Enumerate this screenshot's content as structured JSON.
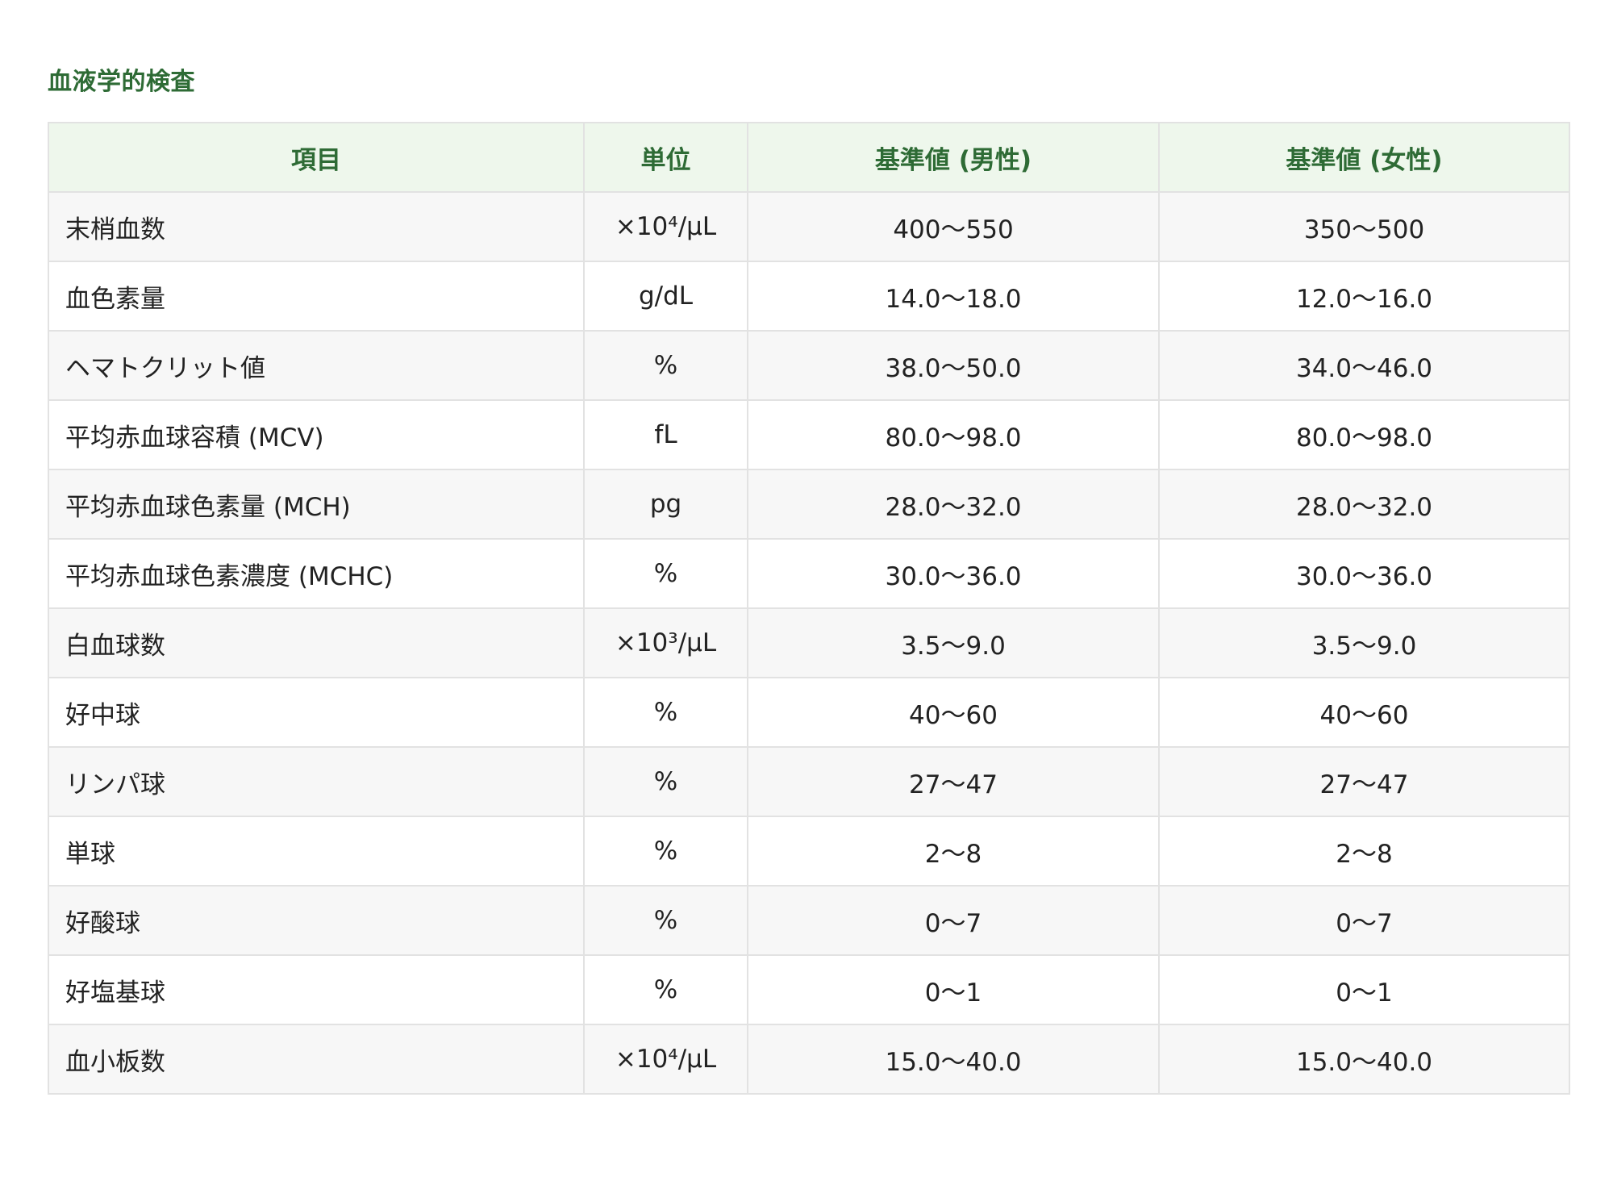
{
  "section": {
    "title": "血液学的検査"
  },
  "table": {
    "headers": {
      "item": "項目",
      "unit": "単位",
      "male": "基準値 (男性)",
      "female": "基準値 (女性)"
    },
    "rows": [
      {
        "item": "末梢血数",
        "unit": "×10⁴/μL",
        "male": "400〜550",
        "female": "350〜500"
      },
      {
        "item": "血色素量",
        "unit": "g/dL",
        "male": "14.0〜18.0",
        "female": "12.0〜16.0"
      },
      {
        "item": "ヘマトクリット値",
        "unit": "%",
        "male": "38.0〜50.0",
        "female": "34.0〜46.0"
      },
      {
        "item": "平均赤血球容積 (MCV)",
        "unit": "fL",
        "male": "80.0〜98.0",
        "female": "80.0〜98.0"
      },
      {
        "item": "平均赤血球色素量 (MCH)",
        "unit": "pg",
        "male": "28.0〜32.0",
        "female": "28.0〜32.0"
      },
      {
        "item": "平均赤血球色素濃度 (MCHC)",
        "unit": "%",
        "male": "30.0〜36.0",
        "female": "30.0〜36.0"
      },
      {
        "item": "白血球数",
        "unit": "×10³/μL",
        "male": "3.5〜9.0",
        "female": "3.5〜9.0"
      },
      {
        "item": "好中球",
        "unit": "%",
        "male": "40〜60",
        "female": "40〜60"
      },
      {
        "item": "リンパ球",
        "unit": "%",
        "male": "27〜47",
        "female": "27〜47"
      },
      {
        "item": "単球",
        "unit": "%",
        "male": "2〜8",
        "female": "2〜8"
      },
      {
        "item": "好酸球",
        "unit": "%",
        "male": "0〜7",
        "female": "0〜7"
      },
      {
        "item": "好塩基球",
        "unit": "%",
        "male": "0〜1",
        "female": "0〜1"
      },
      {
        "item": "血小板数",
        "unit": "×10⁴/μL",
        "male": "15.0〜40.0",
        "female": "15.0〜40.0"
      }
    ]
  },
  "colors": {
    "accent": "#2e6b35",
    "header_bg": "#eef7ec",
    "row_alt_bg": "#f7f7f7",
    "border": "#e2e2e2"
  }
}
